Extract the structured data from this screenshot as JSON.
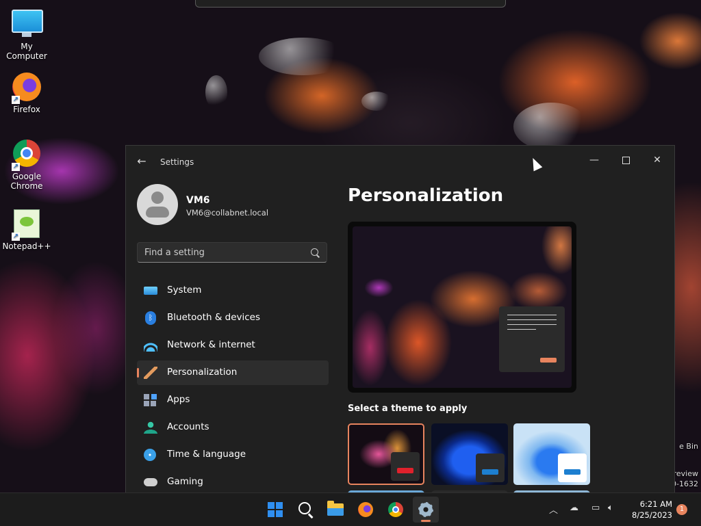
{
  "desktop": {
    "icons": [
      {
        "label": "My Computer"
      },
      {
        "label": "Firefox"
      },
      {
        "label": "Google Chrome"
      },
      {
        "label": "Notepad++"
      }
    ],
    "right_fragments": [
      "e Bin",
      "review",
      "0-1632"
    ]
  },
  "window": {
    "title": "Settings",
    "profile": {
      "name": "VM6",
      "email": "VM6@collabnet.local"
    },
    "search": {
      "placeholder": "Find a setting"
    },
    "nav": [
      {
        "label": "System",
        "icon": "system-icon"
      },
      {
        "label": "Bluetooth & devices",
        "icon": "bluetooth-icon"
      },
      {
        "label": "Network & internet",
        "icon": "wifi-icon"
      },
      {
        "label": "Personalization",
        "icon": "paintbrush-icon",
        "active": true
      },
      {
        "label": "Apps",
        "icon": "apps-icon"
      },
      {
        "label": "Accounts",
        "icon": "accounts-icon"
      },
      {
        "label": "Time & language",
        "icon": "globe-clock-icon"
      },
      {
        "label": "Gaming",
        "icon": "gamepad-icon"
      }
    ],
    "content": {
      "page_title": "Personalization",
      "themes_label": "Select a theme to apply",
      "theme_accents": [
        "#e0212c",
        "#1d7fd0",
        "#1d7fd0"
      ]
    },
    "accent_color": "#e8845e"
  },
  "taskbar": {
    "apps": [
      "start-icon",
      "search-icon",
      "file-explorer-icon",
      "firefox-icon",
      "chrome-icon",
      "settings-icon"
    ],
    "clock_time": "6:21 AM",
    "clock_date": "8/25/2023",
    "notification_count": "1"
  }
}
